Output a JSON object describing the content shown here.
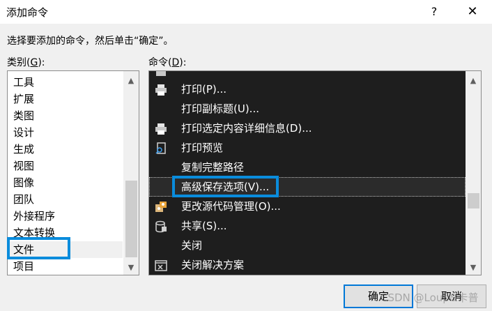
{
  "window": {
    "title": "添加命令",
    "help_label": "?",
    "close_label": "✕"
  },
  "instruction": "选择要添加的命令，然后单击“确定”。",
  "categories_label": {
    "prefix": "类别(",
    "key": "G",
    "suffix": "):"
  },
  "commands_label": {
    "prefix": "命令(",
    "key": "D",
    "suffix": "):"
  },
  "categories": [
    {
      "label": "工具",
      "selected": false
    },
    {
      "label": "扩展",
      "selected": false
    },
    {
      "label": "类图",
      "selected": false
    },
    {
      "label": "设计",
      "selected": false
    },
    {
      "label": "生成",
      "selected": false
    },
    {
      "label": "视图",
      "selected": false
    },
    {
      "label": "图像",
      "selected": false
    },
    {
      "label": "团队",
      "selected": false
    },
    {
      "label": "外接程序",
      "selected": false
    },
    {
      "label": "文本转换",
      "selected": false
    },
    {
      "label": "文件",
      "selected": true
    },
    {
      "label": "项目",
      "selected": false
    }
  ],
  "commands": [
    {
      "label": "打印(P)...",
      "icon": "printer-icon"
    },
    {
      "label": "打印副标题(U)...",
      "icon": ""
    },
    {
      "label": "打印选定内容详细信息(D)...",
      "icon": "printer-icon"
    },
    {
      "label": "打印预览",
      "icon": "print-preview-icon"
    },
    {
      "label": "复制完整路径",
      "icon": ""
    },
    {
      "label": "高级保存选项(V)...",
      "icon": "",
      "selected": true
    },
    {
      "label": "更改源代码管理(O)...",
      "icon": "source-control-icon"
    },
    {
      "label": "共享(S)...",
      "icon": "share-icon"
    },
    {
      "label": "关闭",
      "icon": ""
    },
    {
      "label": "关闭解决方案",
      "icon": "close-solution-icon"
    }
  ],
  "buttons": {
    "ok": "确定",
    "cancel": "取消"
  },
  "watermark": "CSDN @Loup&卡普",
  "colors": {
    "accent": "#0a8cdc",
    "list_bg": "#1e1e1e"
  }
}
